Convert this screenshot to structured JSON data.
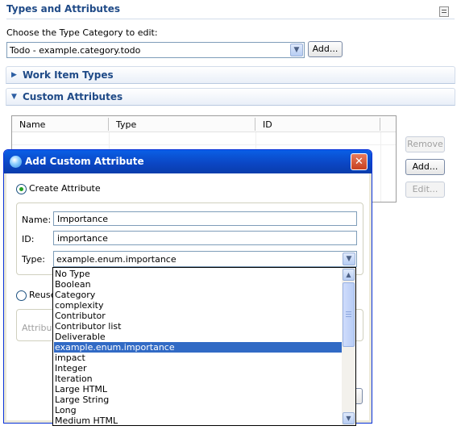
{
  "page": {
    "section_title": "Types and Attributes",
    "category_label": "Choose the Type Category to edit:",
    "category_value": "Todo - example.category.todo",
    "add_category_label": "Add...",
    "work_item_types_label": "Work Item Types",
    "custom_attributes_label": "Custom Attributes",
    "table_columns": [
      "Name",
      "Type",
      "ID"
    ],
    "side_buttons": {
      "remove": "Remove",
      "add": "Add...",
      "edit": "Edit..."
    }
  },
  "dialog": {
    "title": "Add Custom Attribute",
    "close_glyph": "✕",
    "create_option": "Create Attribute",
    "name_label": "Name:",
    "name_value": "Importance",
    "id_label": "ID:",
    "id_value": "importance",
    "type_label": "Type:",
    "type_value": "example.enum.importance",
    "reuse_option": "Reuse",
    "attribute_label": "Attribut"
  },
  "type_list": {
    "items": [
      "No Type",
      "Boolean",
      "Category",
      "complexity",
      "Contributor",
      "Contributor list",
      "Deliverable",
      "example.enum.importance",
      "impact",
      "Integer",
      "Iteration",
      "Large HTML",
      "Large String",
      "Long",
      "Medium HTML"
    ],
    "selected_index": 7
  },
  "colors": {
    "accent": "#1f4a87",
    "selection": "#316ac5",
    "dialog_title": "#0a5fe6"
  }
}
